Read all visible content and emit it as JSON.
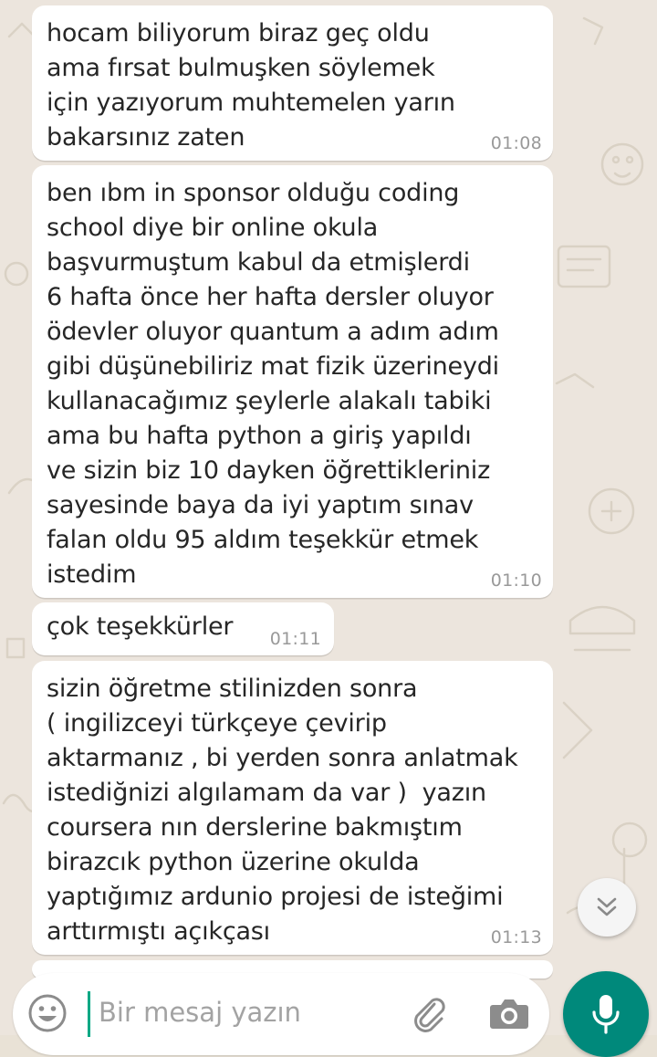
{
  "conversation": {
    "messages": [
      {
        "text": "hocam biliyorum biraz geç oldu\nama fırsat bulmuşken söylemek\niçin yazıyorum muhtemelen yarın\nbakarsınız zaten",
        "time": "01:08"
      },
      {
        "text": "ben ıbm in sponsor olduğu coding\nschool diye bir online okula\nbaşvurmuştum kabul da etmişlerdi\n6 hafta önce her hafta dersler oluyor\nödevler oluyor quantum a adım adım\ngibi düşünebiliriz mat fizik üzerineydi\nkullanacağımız şeylerle alakalı tabiki\nama bu hafta python a giriş yapıldı\nve sizin biz 10 dayken öğrettikleriniz\nsayesinde baya da iyi yaptım sınav\nfalan oldu 95 aldım teşekkür etmek\nistedim",
        "time": "01:10"
      },
      {
        "text": "çok teşekkürler",
        "time": "01:11"
      },
      {
        "text": "sizin öğretme stilinizden sonra\n( ingilizceyi türkçeye çevirip\naktarmanız , bi yerden sonra anlatmak\nistediğnizi algılamam da var )  yazın\ncoursera nın derslerine bakmıştım\nbirazcık python üzerine okulda\nyaptığımız ardunio projesi de isteğimi\narttırmıştı açıkçası",
        "time": "01:13"
      }
    ]
  },
  "composer": {
    "placeholder": "Bir mesaj yazın"
  },
  "icons": {
    "emoji": "emoji-icon",
    "attach": "paperclip-icon",
    "camera": "camera-icon",
    "mic": "microphone-icon",
    "scroll_down": "chevron-double-down-icon"
  },
  "colors": {
    "bubble": "#ffffff",
    "wallpaper": "#ece5dd",
    "accent": "#00897b",
    "timestamp": "#999999",
    "text": "#262626"
  }
}
